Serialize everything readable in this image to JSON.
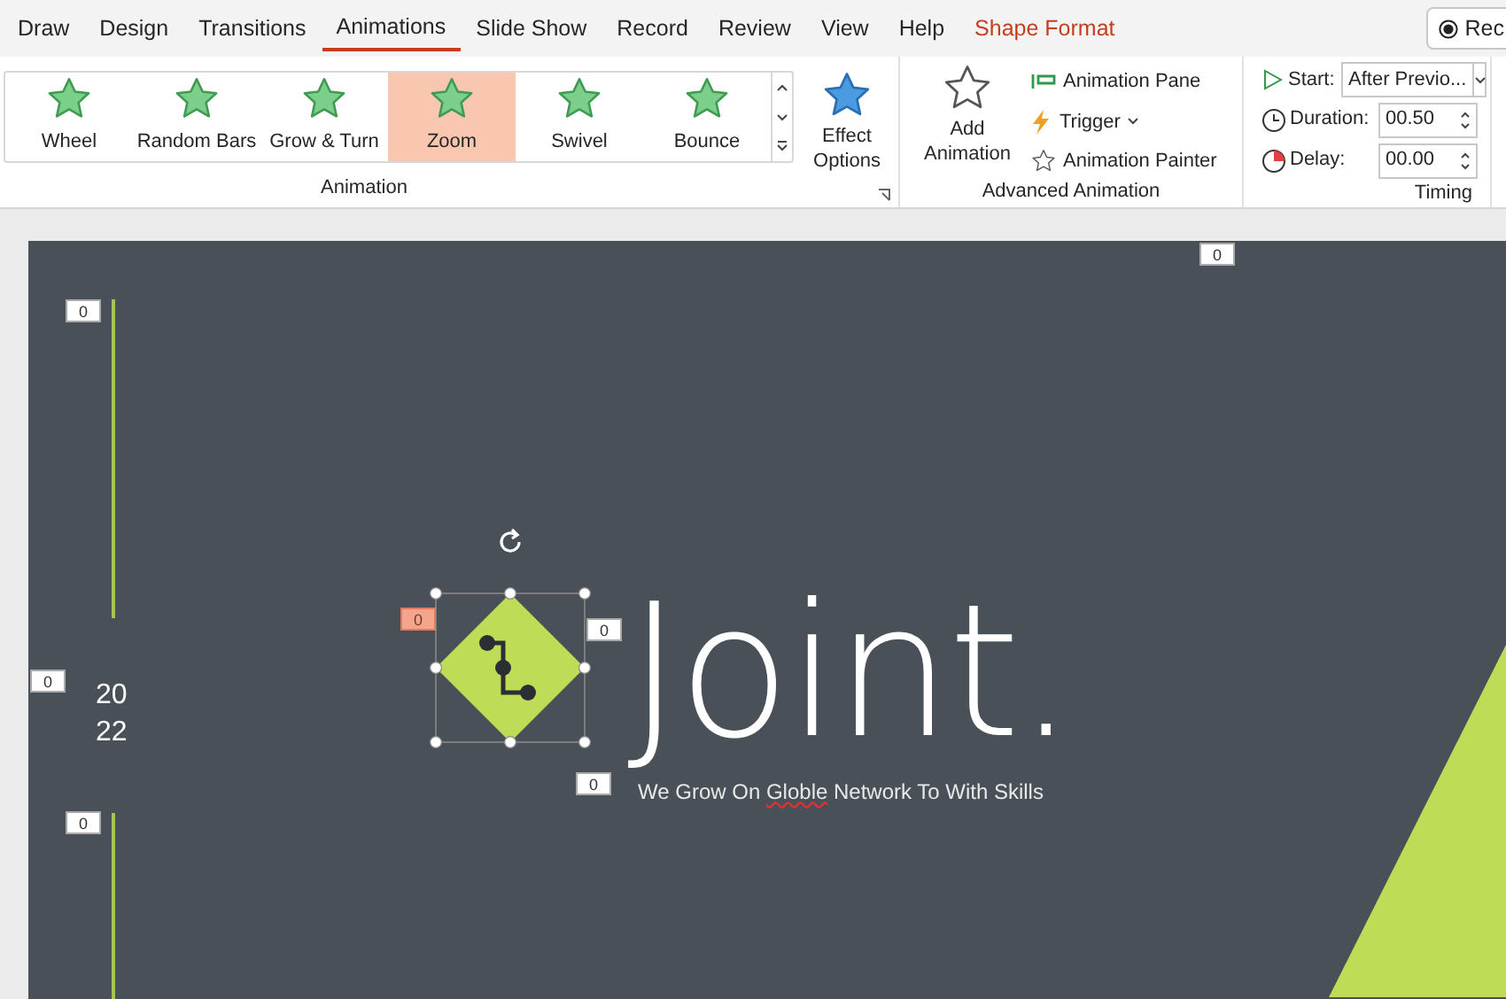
{
  "ribbon_tabs": [
    {
      "label": "Draw",
      "selected": false,
      "kind": "normal"
    },
    {
      "label": "Design",
      "selected": false,
      "kind": "normal"
    },
    {
      "label": "Transitions",
      "selected": false,
      "kind": "normal"
    },
    {
      "label": "Animations",
      "selected": true,
      "kind": "normal"
    },
    {
      "label": "Slide Show",
      "selected": false,
      "kind": "normal"
    },
    {
      "label": "Record",
      "selected": false,
      "kind": "normal"
    },
    {
      "label": "Review",
      "selected": false,
      "kind": "normal"
    },
    {
      "label": "View",
      "selected": false,
      "kind": "normal"
    },
    {
      "label": "Help",
      "selected": false,
      "kind": "normal"
    },
    {
      "label": "Shape Format",
      "selected": false,
      "kind": "contextual"
    }
  ],
  "record_button": {
    "label": "Rec"
  },
  "animation_group": {
    "label": "Animation",
    "effects": [
      {
        "label": "Wheel",
        "selected": false
      },
      {
        "label": "Random Bars",
        "selected": false
      },
      {
        "label": "Grow & Turn",
        "selected": false
      },
      {
        "label": "Zoom",
        "selected": true
      },
      {
        "label": "Swivel",
        "selected": false
      },
      {
        "label": "Bounce",
        "selected": false
      }
    ],
    "effect_options": {
      "label": "Effect Options"
    }
  },
  "advanced_group": {
    "label": "Advanced Animation",
    "add_animation": "Add Animation",
    "pane": "Animation Pane",
    "trigger": "Trigger",
    "painter": "Animation Painter"
  },
  "timing_group": {
    "label": "Timing",
    "start_label": "Start:",
    "start_value": "After Previo...",
    "duration_label": "Duration:",
    "duration_value": "00.50",
    "delay_label": "Delay:",
    "delay_value": "00.00"
  },
  "slide": {
    "year_lines": [
      "20",
      "22"
    ],
    "title": "Joint.",
    "subtitle": [
      {
        "text": "We Grow On ",
        "misspelled": false
      },
      {
        "text": "Globle",
        "misspelled": true
      },
      {
        "text": " Network To With Skills",
        "misspelled": false
      }
    ],
    "animation_tags": [
      {
        "label": "0",
        "selected": false
      },
      {
        "label": "0",
        "selected": false
      },
      {
        "label": "0",
        "selected": true
      },
      {
        "label": "0",
        "selected": false
      },
      {
        "label": "0",
        "selected": false
      },
      {
        "label": "0",
        "selected": false
      },
      {
        "label": "0",
        "selected": false
      }
    ]
  }
}
